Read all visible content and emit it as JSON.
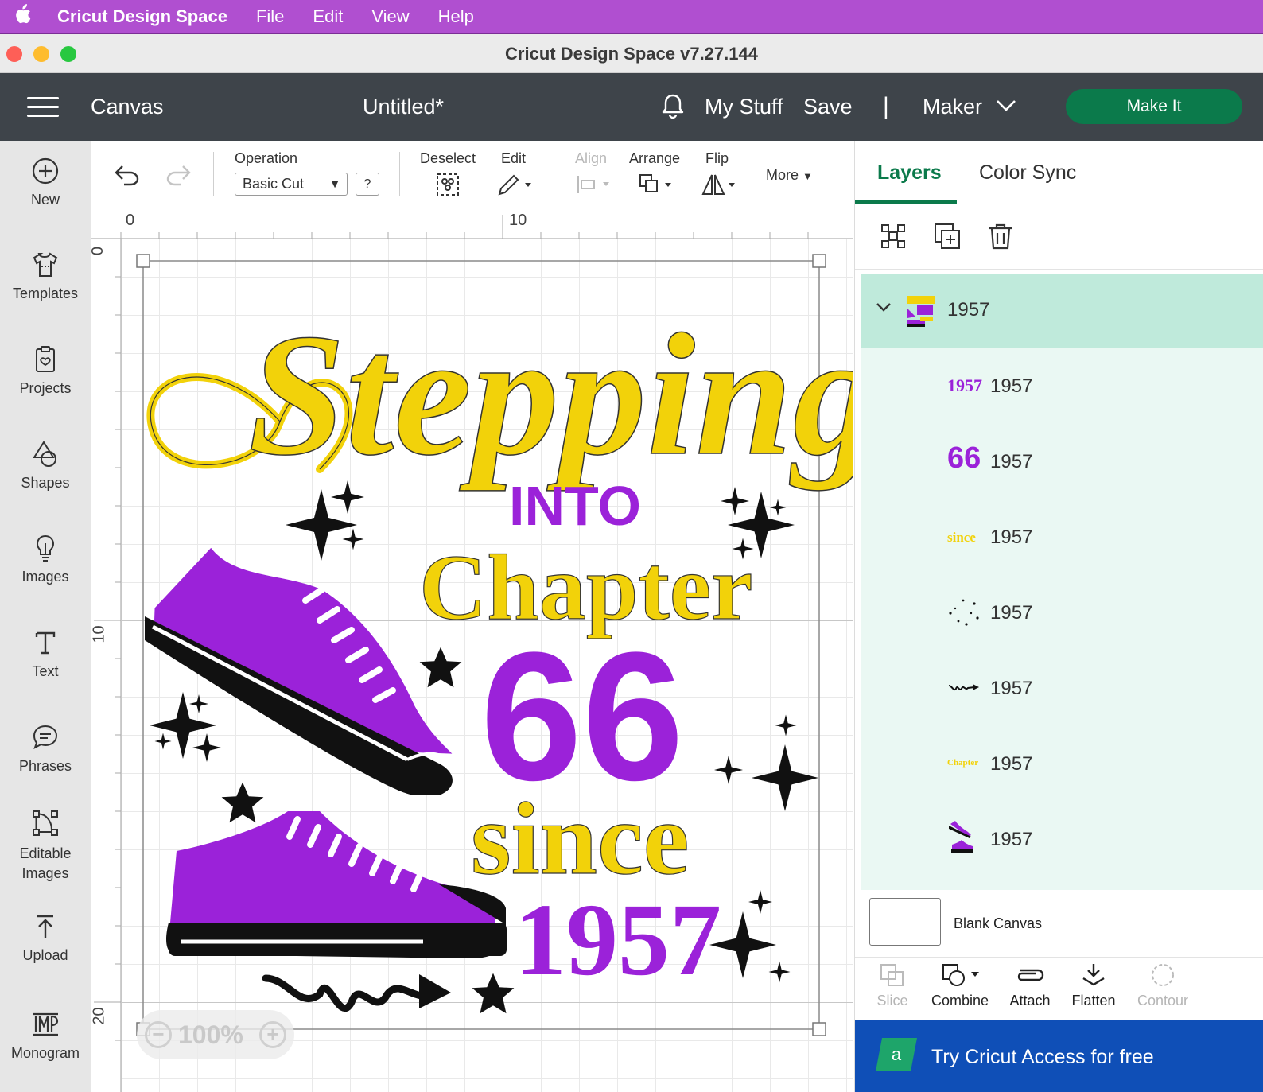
{
  "menubar": {
    "app_name": "Cricut Design Space",
    "items": [
      "File",
      "Edit",
      "View",
      "Help"
    ]
  },
  "window": {
    "title": "Cricut Design Space  v7.27.144"
  },
  "header": {
    "section": "Canvas",
    "doc_title": "Untitled*",
    "my_stuff": "My Stuff",
    "save": "Save",
    "separator": "|",
    "machine": "Maker",
    "make_it": "Make It"
  },
  "sidebar": {
    "items": [
      {
        "label": "New",
        "icon": "plus-circle-icon"
      },
      {
        "label": "Templates",
        "icon": "tshirt-icon"
      },
      {
        "label": "Projects",
        "icon": "clipboard-heart-icon"
      },
      {
        "label": "Shapes",
        "icon": "shapes-icon"
      },
      {
        "label": "Images",
        "icon": "lightbulb-icon"
      },
      {
        "label": "Text",
        "icon": "text-t-icon"
      },
      {
        "label": "Phrases",
        "icon": "speech-bubble-icon"
      },
      {
        "label": "Editable Images",
        "icon": "vector-node-icon"
      },
      {
        "label": "Upload",
        "icon": "upload-arrow-icon"
      },
      {
        "label": "Monogram",
        "icon": "monogram-icon"
      }
    ]
  },
  "toolbar": {
    "operation_label": "Operation",
    "operation_value": "Basic Cut",
    "help": "?",
    "deselect": "Deselect",
    "edit": "Edit",
    "align": "Align",
    "arrange": "Arrange",
    "flip": "Flip",
    "more": "More"
  },
  "rulers": {
    "top": [
      "0",
      "10"
    ],
    "left": [
      "0",
      "10",
      "20"
    ]
  },
  "canvas": {
    "zoom": "100%",
    "design_text": {
      "word1": "Stepping",
      "word2": "INTO",
      "word3": "Chapter",
      "word4": "66",
      "word5": "since",
      "word6": "1957"
    },
    "colors": {
      "yellow": "#f2d20a",
      "purple": "#9b22d9",
      "black": "#111111"
    }
  },
  "panel": {
    "tabs": [
      "Layers",
      "Color Sync"
    ],
    "group_name": "1957",
    "layers": [
      {
        "thumb": "1957",
        "name": "1957"
      },
      {
        "thumb": "66",
        "name": "1957"
      },
      {
        "thumb": "since",
        "name": "1957"
      },
      {
        "thumb": "",
        "name": "1957"
      },
      {
        "thumb": "",
        "name": "1957"
      },
      {
        "thumb": "Chapter",
        "name": "1957"
      },
      {
        "thumb": "",
        "name": "1957"
      }
    ],
    "blank_canvas": "Blank Canvas",
    "bottom_tools": [
      {
        "label": "Slice",
        "enabled": false
      },
      {
        "label": "Combine",
        "enabled": true
      },
      {
        "label": "Attach",
        "enabled": true
      },
      {
        "label": "Flatten",
        "enabled": true
      },
      {
        "label": "Contour",
        "enabled": false
      }
    ],
    "access_banner": "Try Cricut Access for free",
    "access_logo": "a"
  }
}
